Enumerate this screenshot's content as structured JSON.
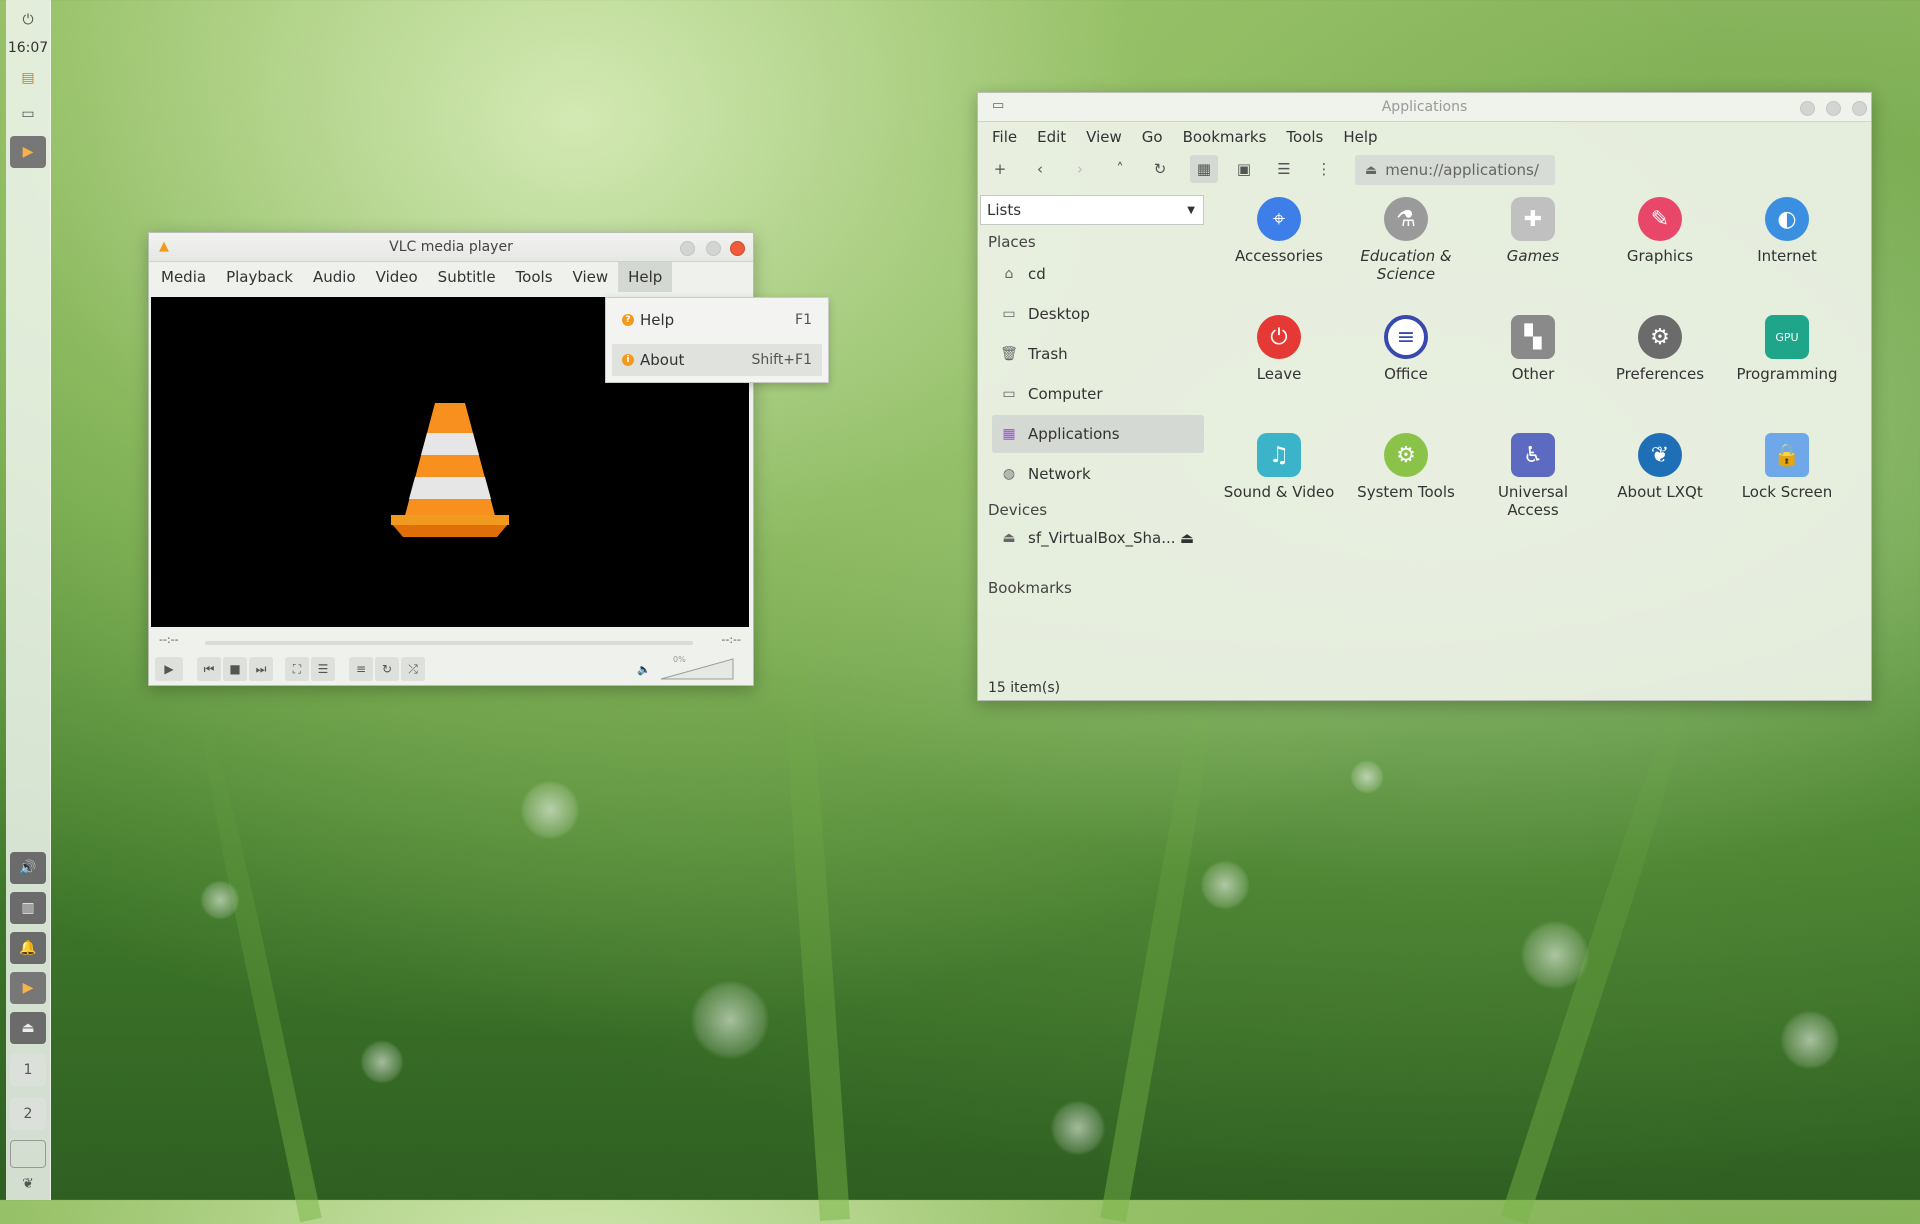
{
  "panel": {
    "clock": "16:07",
    "workspaces": [
      "1",
      "2"
    ]
  },
  "vlc": {
    "title": "VLC media player",
    "menu": [
      "Media",
      "Playback",
      "Audio",
      "Video",
      "Subtitle",
      "Tools",
      "View",
      "Help"
    ],
    "elapsed": "--:--",
    "remaining": "--:--",
    "volume": "0%"
  },
  "help_menu": {
    "items": [
      {
        "label": "Help",
        "shortcut": "F1"
      },
      {
        "label": "About",
        "shortcut": "Shift+F1"
      }
    ]
  },
  "filemanager": {
    "title": "Applications",
    "menu": [
      "File",
      "Edit",
      "View",
      "Go",
      "Bookmarks",
      "Tools",
      "Help"
    ],
    "address": "menu://applications/",
    "side_mode": "Lists",
    "places_heading": "Places",
    "places": [
      "cd",
      "Desktop",
      "Trash",
      "Computer",
      "Applications",
      "Network"
    ],
    "devices_heading": "Devices",
    "devices": [
      "sf_VirtualBox_Sha..."
    ],
    "bookmarks_heading": "Bookmarks",
    "apps": [
      {
        "label": "Accessories",
        "color": "#3d7ee8"
      },
      {
        "label": "Education & Science",
        "color": "#9a9a9a"
      },
      {
        "label": "Games",
        "color": "#b5b5b5"
      },
      {
        "label": "Graphics",
        "color": "#e8476a"
      },
      {
        "label": "Internet",
        "color": "#3a8fe0"
      },
      {
        "label": "Leave",
        "color": "#e53935"
      },
      {
        "label": "Office",
        "color": "#3949ab"
      },
      {
        "label": "Other",
        "color": "#8a8a8a"
      },
      {
        "label": "Preferences",
        "color": "#6b6b6b"
      },
      {
        "label": "Programming",
        "color": "#1fa58a"
      },
      {
        "label": "Sound & Video",
        "color": "#3bb3c8"
      },
      {
        "label": "System Tools",
        "color": "#8bc34a"
      },
      {
        "label": "Universal Access",
        "color": "#5c6bc0"
      },
      {
        "label": "About LXQt",
        "color": "#1e6fb5"
      },
      {
        "label": "Lock Screen",
        "color": "#6fa8e8"
      }
    ],
    "status": "15 item(s)"
  }
}
